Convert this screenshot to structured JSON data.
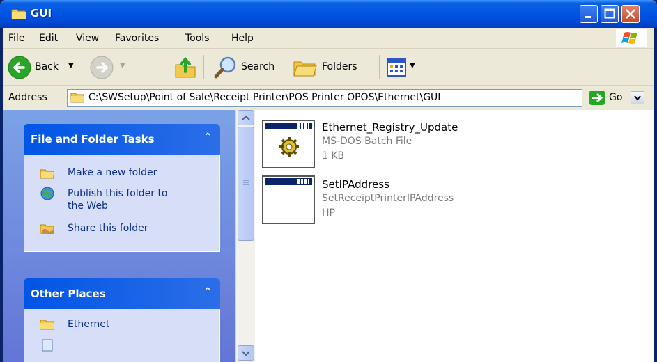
{
  "window": {
    "title": "GUI"
  },
  "menu": {
    "items": [
      "File",
      "Edit",
      "View",
      "Favorites",
      "Tools",
      "Help"
    ]
  },
  "toolbar": {
    "back_label": "Back",
    "search_label": "Search",
    "folders_label": "Folders"
  },
  "address": {
    "label": "Address",
    "path": "C:\\SWSetup\\Point of Sale\\Receipt Printer\\POS Printer OPOS\\Ethernet\\GUI",
    "go_label": "Go"
  },
  "taskpane": {
    "file_tasks": {
      "title": "File and Folder Tasks",
      "links": [
        "Make a new folder",
        "Publish this folder to",
        "the Web",
        "Share this folder"
      ]
    },
    "other_places": {
      "title": "Other Places",
      "links": [
        "Ethernet"
      ]
    }
  },
  "files": [
    {
      "name": "Ethernet_Registry_Update",
      "line2": "MS-DOS Batch File",
      "line3": "1 KB",
      "icon": "batch-gear-icon"
    },
    {
      "name": "SetIPAddress",
      "line2": "SetReceiptPrinterIPAddress",
      "line3": "HP",
      "icon": "application-window-icon"
    }
  ],
  "colors": {
    "titlebar": "#0055e5",
    "taskpane_bg": "#7ba2e7",
    "link": "#0c2f8a",
    "close": "#d95b3a"
  }
}
